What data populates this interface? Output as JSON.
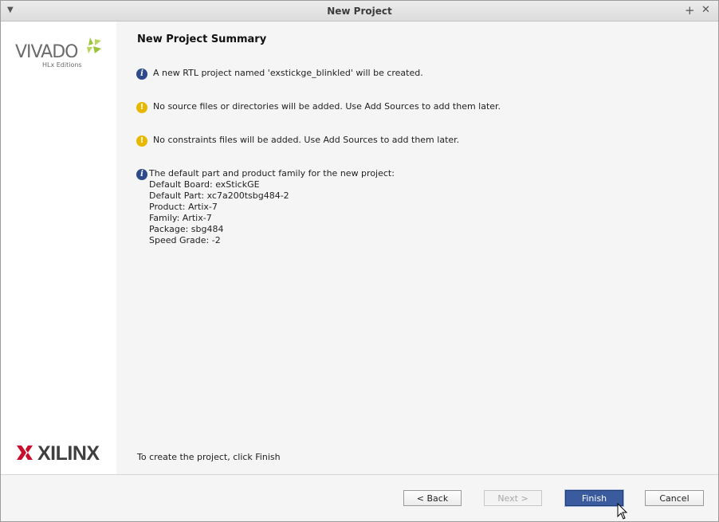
{
  "window": {
    "title": "New Project"
  },
  "sidebar": {
    "vivado_logo": "VIVADO",
    "vivado_subtitle": "HLx Editions",
    "xilinx_logo": "XILINX"
  },
  "page": {
    "heading": "New Project Summary",
    "messages": [
      {
        "type": "info",
        "text": "A new RTL project named 'exstickge_blinkled' will be created."
      },
      {
        "type": "warning",
        "text": "No source files or directories will be added. Use Add Sources to add them later."
      },
      {
        "type": "warning",
        "text": "No constraints files will be added. Use Add Sources to add them later."
      }
    ],
    "part_info": {
      "intro": "The default part and product family for the new project:",
      "lines": [
        "Default Board: exStickGE",
        "Default Part: xc7a200tsbg484-2",
        "Product: Artix-7",
        "Family: Artix-7",
        "Package: sbg484",
        "Speed Grade: -2"
      ]
    },
    "footer_note": "To create the project, click Finish"
  },
  "buttons": {
    "back": "< Back",
    "next": "Next >",
    "finish": "Finish",
    "cancel": "Cancel"
  },
  "colors": {
    "info_icon": "#2d4a8a",
    "warning_icon": "#e8b800",
    "primary_button": "#3a5b9e",
    "vivado_leaf": "#9cc43a",
    "xilinx_red": "#c8102e"
  }
}
